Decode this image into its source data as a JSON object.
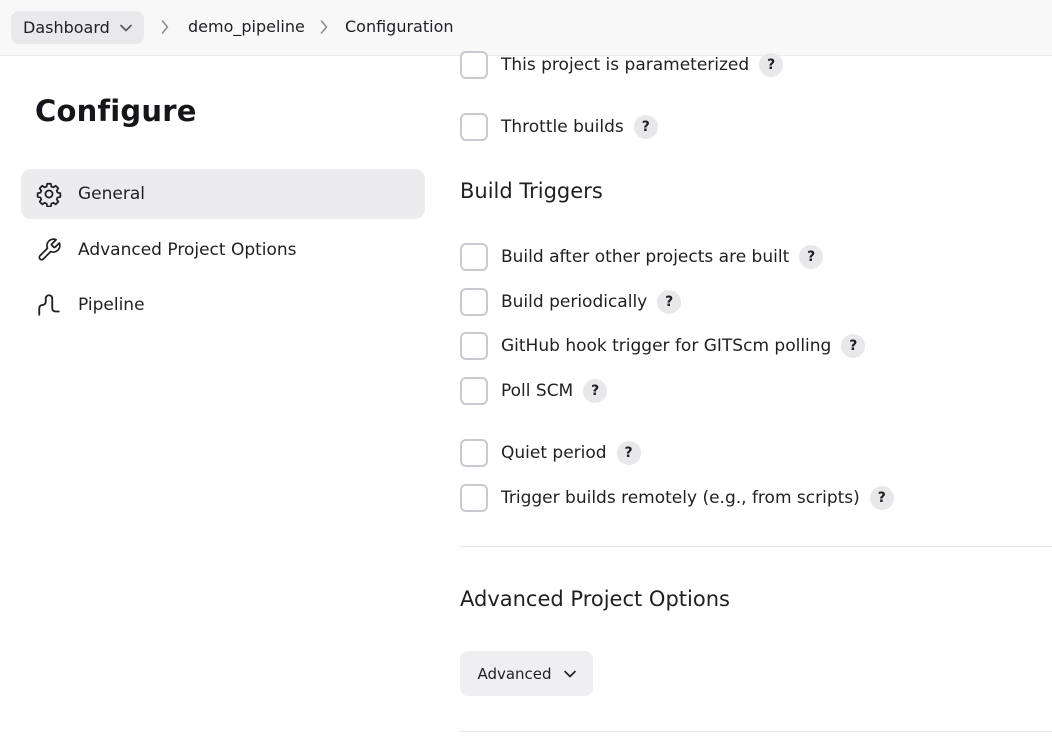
{
  "breadcrumb": {
    "root": "Dashboard",
    "items": [
      "demo_pipeline",
      "Configuration"
    ]
  },
  "sidebar": {
    "title": "Configure",
    "items": [
      {
        "label": "General",
        "icon": "gear-icon",
        "active": true
      },
      {
        "label": "Advanced Project Options",
        "icon": "wrench-icon",
        "active": false
      },
      {
        "label": "Pipeline",
        "icon": "pipeline-icon",
        "active": false
      }
    ]
  },
  "general": {
    "options": [
      {
        "label": "This project is parameterized",
        "checked": false
      },
      {
        "label": "Throttle builds",
        "checked": false
      }
    ]
  },
  "build_triggers": {
    "title": "Build Triggers",
    "options": [
      {
        "label": "Build after other projects are built",
        "checked": false
      },
      {
        "label": "Build periodically",
        "checked": false
      },
      {
        "label": "GitHub hook trigger for GITScm polling",
        "checked": false
      },
      {
        "label": "Poll SCM",
        "checked": false
      },
      {
        "label": "Quiet period",
        "checked": false
      },
      {
        "label": "Trigger builds remotely (e.g., from scripts)",
        "checked": false
      }
    ]
  },
  "advanced_options": {
    "title": "Advanced Project Options",
    "button_label": "Advanced"
  },
  "help_glyph": "?",
  "colors": {
    "active_item_bg": "#ececef",
    "checkbox_border": "#c9c9cf",
    "help_bg": "#e8e8eb",
    "topbar_bg": "#f8f8f9"
  }
}
